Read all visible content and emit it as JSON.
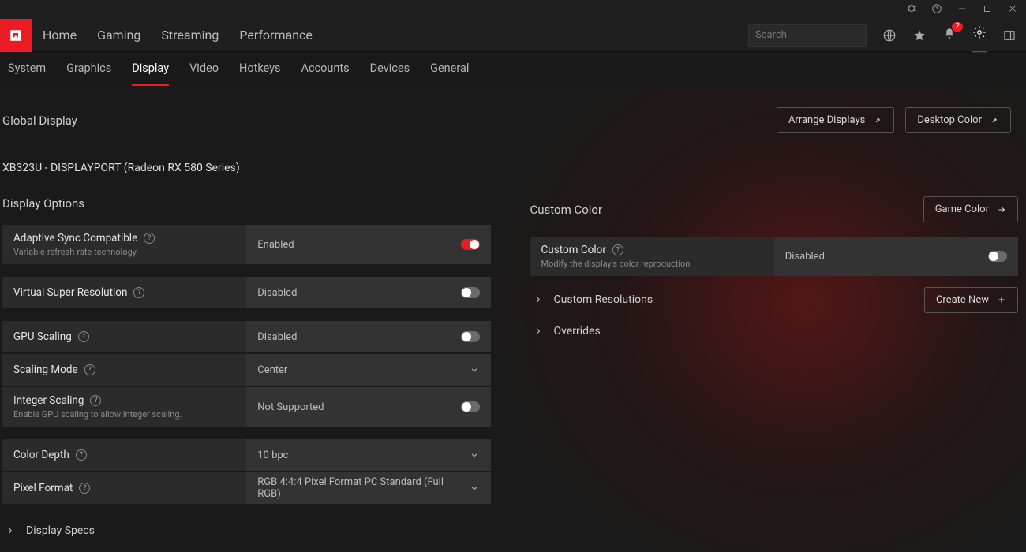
{
  "titlebar": {
    "badge": "2"
  },
  "nav": {
    "home": "Home",
    "gaming": "Gaming",
    "streaming": "Streaming",
    "performance": "Performance"
  },
  "search": {
    "placeholder": "Search"
  },
  "subtabs": {
    "system": "System",
    "graphics": "Graphics",
    "display": "Display",
    "video": "Video",
    "hotkeys": "Hotkeys",
    "accounts": "Accounts",
    "devices": "Devices",
    "general": "General",
    "active": "display"
  },
  "page": {
    "global_title": "Global Display",
    "arrange": "Arrange Displays",
    "desktop_color": "Desktop Color",
    "device": "XB323U - DISPLAYPORT (Radeon RX 580 Series)"
  },
  "left": {
    "title": "Display Options",
    "rows": {
      "adaptive": {
        "label": "Adaptive Sync Compatible",
        "sub": "Variable-refresh-rate technology",
        "value": "Enabled",
        "toggle": true
      },
      "vsr": {
        "label": "Virtual Super Resolution",
        "value": "Disabled",
        "toggle": false
      },
      "gpu": {
        "label": "GPU Scaling",
        "value": "Disabled",
        "toggle": false
      },
      "smode": {
        "label": "Scaling Mode",
        "value": "Center",
        "type": "select"
      },
      "iscale": {
        "label": "Integer Scaling",
        "sub": "Enable GPU scaling to allow integer scaling.",
        "value": "Not Supported",
        "toggle": false
      },
      "depth": {
        "label": "Color Depth",
        "value": "10 bpc",
        "type": "select"
      },
      "pixfmt": {
        "label": "Pixel Format",
        "value": "RGB 4:4:4 Pixel Format PC Standard (Full RGB)",
        "type": "select"
      }
    },
    "specs": "Display Specs"
  },
  "right": {
    "title": "Custom Color",
    "game_color": "Game Color",
    "rows": {
      "custom": {
        "label": "Custom Color",
        "sub": "Modify the display's color reproduction",
        "value": "Disabled",
        "toggle": false
      }
    },
    "custom_res": "Custom Resolutions",
    "create_new": "Create New",
    "overrides": "Overrides"
  }
}
